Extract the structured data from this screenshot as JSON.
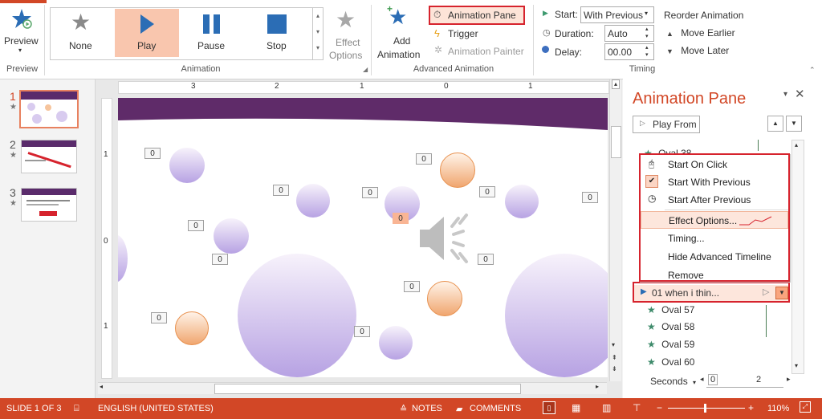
{
  "ribbon": {
    "preview": {
      "label": "Preview",
      "group": "Preview"
    },
    "animation_group": "Animation",
    "effects": [
      {
        "label": "None"
      },
      {
        "label": "Play"
      },
      {
        "label": "Pause"
      },
      {
        "label": "Stop"
      }
    ],
    "effect_options": {
      "line1": "Effect",
      "line2": "Options"
    },
    "add_animation": {
      "line1": "Add",
      "line2": "Animation"
    },
    "advanced_group": "Advanced Animation",
    "animation_pane_btn": "Animation Pane",
    "trigger": "Trigger",
    "animation_painter": "Animation Painter",
    "timing_group": "Timing",
    "start_label": "Start:",
    "start_value": "With Previous",
    "duration_label": "Duration:",
    "duration_value": "Auto",
    "delay_label": "Delay:",
    "delay_value": "00.00",
    "reorder_title": "Reorder Animation",
    "move_earlier": "Move Earlier",
    "move_later": "Move Later"
  },
  "slides_panel": {
    "slides": [
      {
        "num": "1"
      },
      {
        "num": "2"
      },
      {
        "num": "3"
      }
    ]
  },
  "ruler": {
    "marks": [
      "3",
      "2",
      "1",
      "0",
      "1"
    ],
    "vmarks": [
      "1",
      "0",
      "1"
    ]
  },
  "slide": {
    "tags": [
      "0",
      "0",
      "0",
      "0",
      "0",
      "0",
      "0",
      "0",
      "0",
      "0",
      "0",
      "0"
    ]
  },
  "animation_pane": {
    "title": "Animation Pane",
    "play_from": "Play From",
    "items_top": [
      {
        "label": "Oval 38"
      }
    ],
    "selected_item": "01 when i thin...",
    "items_bottom": [
      {
        "label": "Oval 57"
      },
      {
        "label": "Oval 58"
      },
      {
        "label": "Oval 59"
      },
      {
        "label": "Oval 60"
      }
    ],
    "seconds_label": "Seconds",
    "timeline_0": "0",
    "timeline_2": "2"
  },
  "context_menu": {
    "items": [
      {
        "label": "Start On Click",
        "icon": "mouse-icon"
      },
      {
        "label": "Start With Previous",
        "icon": "check-icon"
      },
      {
        "label": "Start After Previous",
        "icon": "clock-icon"
      },
      {
        "label": "Effect Options..."
      },
      {
        "label": "Timing..."
      },
      {
        "label": "Hide Advanced Timeline"
      },
      {
        "label": "Remove"
      }
    ]
  },
  "statusbar": {
    "slide_info": "SLIDE 1 OF 3",
    "language": "ENGLISH (UNITED STATES)",
    "notes": "NOTES",
    "comments": "COMMENTS",
    "zoom": "110%"
  },
  "colors": {
    "accent": "#d24726",
    "highlight": "#d6232d",
    "play_selected": "#f9c6ae",
    "star": "#3d8a6a"
  }
}
